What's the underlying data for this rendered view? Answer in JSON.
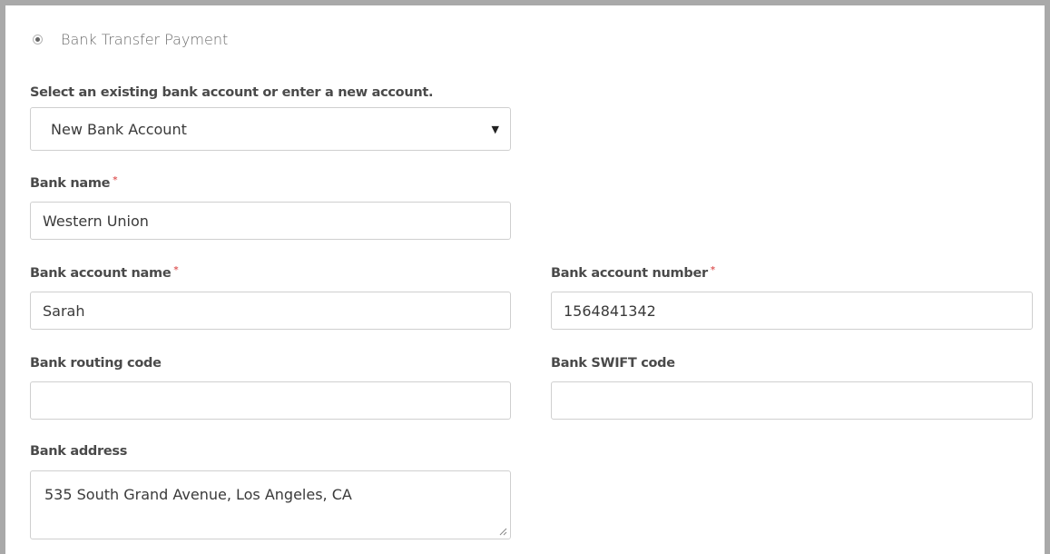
{
  "payment_method": {
    "label": "Bank Transfer Payment",
    "selected": true
  },
  "account_select": {
    "label": "Select an existing bank account or enter a new account.",
    "value": "New Bank Account"
  },
  "bank_name": {
    "label": "Bank name",
    "required_mark": "*",
    "value": "Western Union"
  },
  "bank_account_name": {
    "label": "Bank account name",
    "required_mark": "*",
    "value": "Sarah"
  },
  "bank_account_number": {
    "label": "Bank account number",
    "required_mark": "*",
    "value": "1564841342"
  },
  "bank_routing_code": {
    "label": "Bank routing code",
    "value": ""
  },
  "bank_swift_code": {
    "label": "Bank SWIFT code",
    "value": ""
  },
  "bank_address": {
    "label": "Bank address",
    "value": "535 South Grand Avenue, Los Angeles, CA"
  },
  "colors": {
    "frame": "#a9a9a9",
    "required": "#e06060",
    "label": "#4a4a4a"
  },
  "icons": {
    "select_caret": "caret-down-icon",
    "radio": "radio-selected-icon",
    "resize": "resize-grip-icon"
  }
}
